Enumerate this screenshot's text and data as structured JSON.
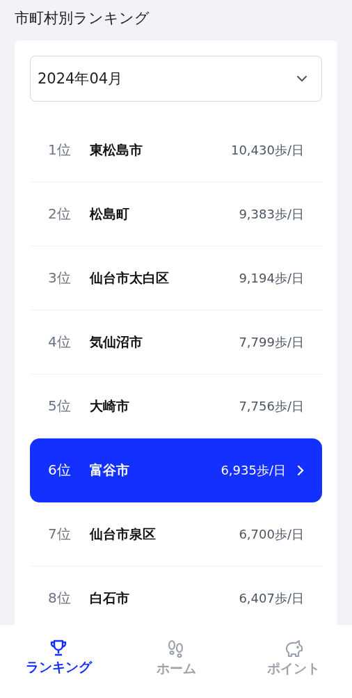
{
  "header": {
    "title": "市町村別ランキング"
  },
  "month_select": {
    "value": "2024年04月"
  },
  "rankings": [
    {
      "rank": "1位",
      "name": "東松島市",
      "steps": "10,430歩/日",
      "selected": false
    },
    {
      "rank": "2位",
      "name": "松島町",
      "steps": "9,383歩/日",
      "selected": false
    },
    {
      "rank": "3位",
      "name": "仙台市太白区",
      "steps": "9,194歩/日",
      "selected": false
    },
    {
      "rank": "4位",
      "name": "気仙沼市",
      "steps": "7,799歩/日",
      "selected": false
    },
    {
      "rank": "5位",
      "name": "大崎市",
      "steps": "7,756歩/日",
      "selected": false
    },
    {
      "rank": "6位",
      "name": "富谷市",
      "steps": "6,935歩/日",
      "selected": true
    },
    {
      "rank": "7位",
      "name": "仙台市泉区",
      "steps": "6,700歩/日",
      "selected": false
    },
    {
      "rank": "8位",
      "name": "白石市",
      "steps": "6,407歩/日",
      "selected": false
    }
  ],
  "bottom_nav": [
    {
      "kind": "ranking",
      "label": "ランキング",
      "selected": true
    },
    {
      "kind": "home",
      "label": "ホーム",
      "selected": false
    },
    {
      "kind": "points",
      "label": "ポイント",
      "selected": false
    }
  ]
}
